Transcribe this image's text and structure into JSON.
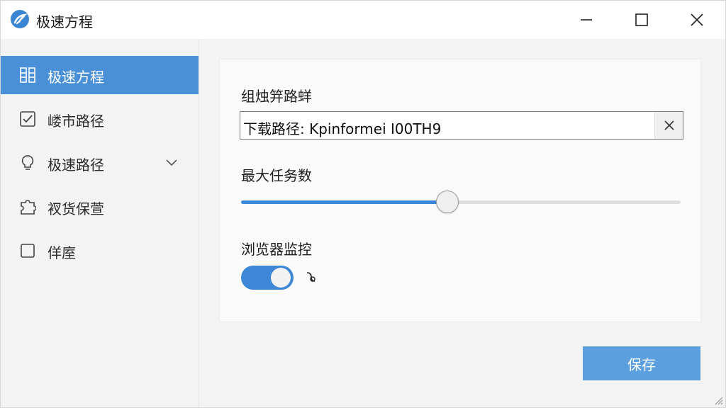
{
  "window": {
    "title": "极速方程",
    "icons": {
      "app": "app-logo-icon",
      "minimize": "minimize-icon",
      "maximize": "maximize-icon",
      "close": "close-icon"
    }
  },
  "sidebar": {
    "items": [
      {
        "label": "极速方程",
        "icon": "grid-icon",
        "active": true
      },
      {
        "label": "嵝市路径",
        "icon": "checkbox-icon",
        "active": false
      },
      {
        "label": "极速路径",
        "icon": "lightbulb-icon",
        "active": false,
        "expandable": true
      },
      {
        "label": "衩货保萱",
        "icon": "puzzle-icon",
        "active": false
      },
      {
        "label": "佯庢",
        "icon": "square-icon",
        "active": false
      }
    ]
  },
  "content": {
    "download_path": {
      "label": "组烛笄路蛘",
      "value": "下载路径: Kpinformei I00TH9",
      "clear_icon": "clear-icon"
    },
    "max_tasks": {
      "label": "最大任务数",
      "slider_value_fraction": 0.47
    },
    "browser_monitor": {
      "label": "浏览器监控",
      "enabled": true
    },
    "save_label": "保存"
  },
  "colors": {
    "accent": "#4a90d6",
    "save_button": "#5b9fdf",
    "slider_fill": "#3d88d6"
  }
}
